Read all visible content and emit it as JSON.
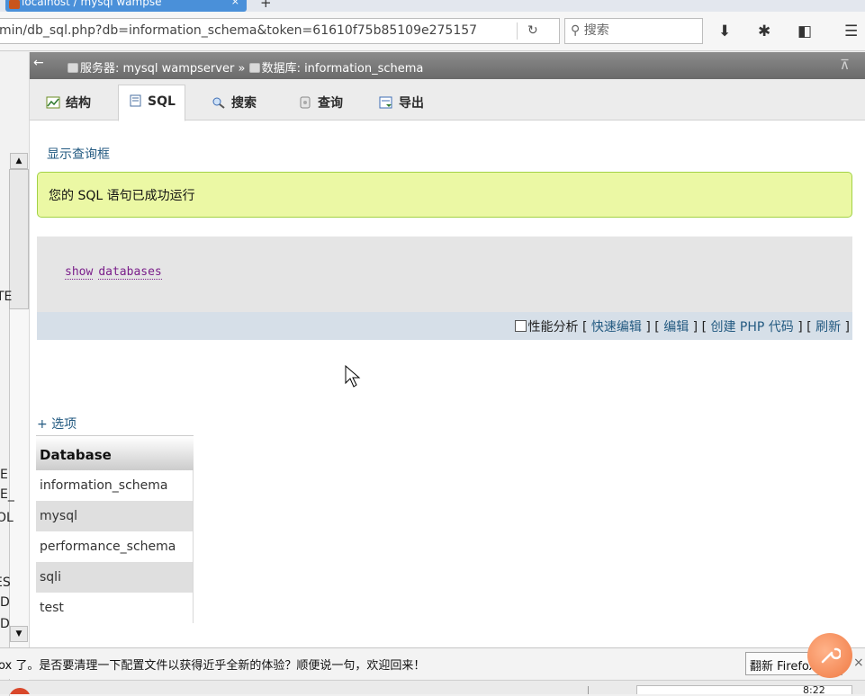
{
  "browser": {
    "tab_title": "localhost / mysql wampse",
    "tab_close": "×",
    "new_tab": "+",
    "url": "min/db_sql.php?db=information_schema&token=61610f75b85109e275157",
    "search_placeholder": "搜索"
  },
  "sidebar": {
    "fragments": [
      "TE",
      "E",
      "E_",
      "OL",
      "ES",
      "D",
      "D"
    ]
  },
  "header": {
    "server_label": "服务器: mysql wampserver",
    "separator": "»",
    "database_label": "数据库: information_schema"
  },
  "tabs": [
    {
      "label": "结构"
    },
    {
      "label": "SQL"
    },
    {
      "label": "搜索"
    },
    {
      "label": "查询"
    },
    {
      "label": "导出"
    }
  ],
  "main": {
    "show_query_link": "显示查询框",
    "success_message": "您的 SQL 语句已成功运行",
    "sql_keywords": [
      "show",
      "databases"
    ],
    "profiling_label": "性能分析",
    "actions": {
      "inline_edit": "快速编辑",
      "edit": "编辑",
      "create_php": "创建 PHP 代码",
      "refresh": "刷新"
    },
    "options_link": "+ 选项"
  },
  "results": {
    "column_header": "Database",
    "rows": [
      "information_schema",
      "mysql",
      "performance_schema",
      "sqli",
      "test"
    ]
  },
  "notification": {
    "message": "ox 了。是否要清理一下配置文件以获得近乎全新的体验？顺便说一句，欢迎回来！",
    "button_label": "翻新 Firefox...",
    "close": "×"
  },
  "taskbar": {
    "clock": "8:22"
  }
}
